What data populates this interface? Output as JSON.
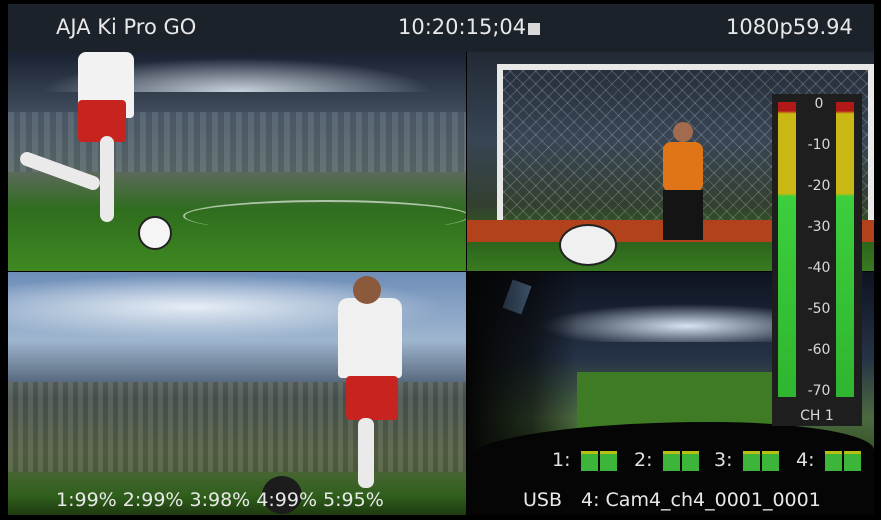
{
  "header": {
    "device_name": "AJA Ki Pro GO",
    "timecode": "10:20:15;04",
    "format": "1080p59.94"
  },
  "quadrants": [
    {
      "scene": "soccer-player-kicking-ball"
    },
    {
      "scene": "goalkeeper-in-goal"
    },
    {
      "scene": "soccer-player-with-ball-stadium"
    },
    {
      "scene": "fans-cheering-stadium"
    }
  ],
  "audio_meter": {
    "scale": [
      "0",
      "-10",
      "-20",
      "-30",
      "-40",
      "-50",
      "-60",
      "-70"
    ],
    "channel_label": "CH 1",
    "colors": {
      "red": "#b11919",
      "yellow": "#c9b814",
      "green": "#3ccf3c"
    }
  },
  "inputs": [
    {
      "label": "1:"
    },
    {
      "label": "2:"
    },
    {
      "label": "3:"
    },
    {
      "label": "4:"
    }
  ],
  "storage": {
    "media_status": "1:99% 2:99% 3:98% 4:99% 5:95%",
    "media_type": "USB",
    "clip_info": "4:  Cam4_ch4_0001_0001"
  }
}
